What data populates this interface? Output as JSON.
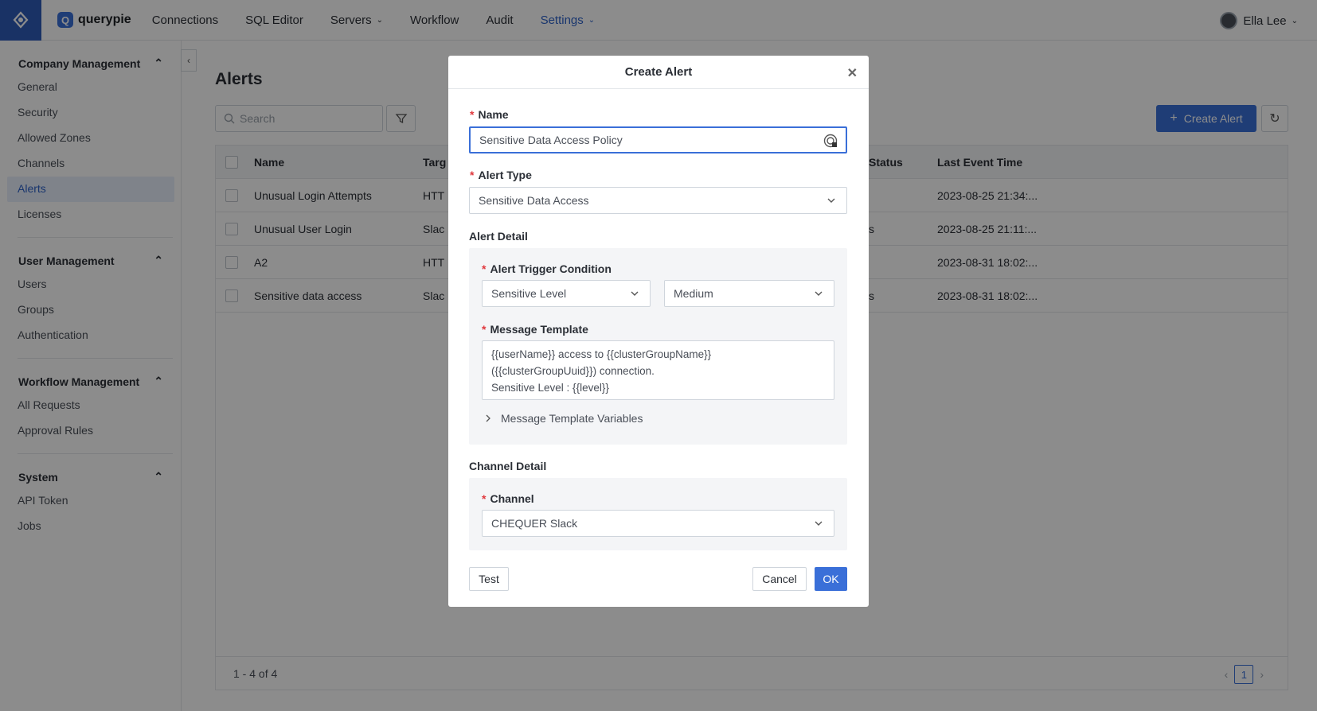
{
  "header": {
    "brand": "querypie",
    "brand_badge": "Q",
    "nav": [
      {
        "label": "Connections"
      },
      {
        "label": "SQL Editor"
      },
      {
        "label": "Servers",
        "has_caret": true
      },
      {
        "label": "Workflow"
      },
      {
        "label": "Audit"
      },
      {
        "label": "Settings",
        "has_caret": true,
        "active": true
      }
    ],
    "user_name": "Ella Lee"
  },
  "sidebar": {
    "groups": [
      {
        "title": "Company Management",
        "items": [
          "General",
          "Security",
          "Allowed Zones",
          "Channels",
          "Alerts",
          "Licenses"
        ],
        "active": "Alerts"
      },
      {
        "title": "User Management",
        "items": [
          "Users",
          "Groups",
          "Authentication"
        ]
      },
      {
        "title": "Workflow Management",
        "items": [
          "All Requests",
          "Approval Rules"
        ]
      },
      {
        "title": "System",
        "items": [
          "API Token",
          "Jobs"
        ]
      }
    ]
  },
  "main": {
    "title": "Alerts",
    "search_placeholder": "Search",
    "create_button": "Create Alert",
    "table": {
      "columns": [
        "Name",
        "Targ",
        "Status",
        "Last Event Time"
      ],
      "rows": [
        {
          "name": "Unusual Login Attempts",
          "target": "HTT",
          "status": "",
          "last_event": "2023-08-25 21:34:..."
        },
        {
          "name": "Unusual User Login",
          "target": "Slac",
          "status": "s",
          "last_event": "2023-08-25 21:11:..."
        },
        {
          "name": "A2",
          "target": "HTT",
          "status": "",
          "last_event": "2023-08-31 18:02:..."
        },
        {
          "name": "Sensitive data access",
          "target": "Slac",
          "status": "s",
          "last_event": "2023-08-31 18:02:..."
        }
      ],
      "footer": "1 - 4 of 4",
      "page": "1"
    }
  },
  "modal": {
    "title": "Create Alert",
    "name_label": "Name",
    "name_value": "Sensitive Data Access Policy",
    "alert_type_label": "Alert Type",
    "alert_type_value": "Sensitive Data Access",
    "alert_detail_title": "Alert Detail",
    "trigger_label": "Alert Trigger Condition",
    "trigger_field": "Sensitive Level",
    "trigger_value": "Medium",
    "message_label": "Message Template",
    "message_lines": [
      "{{userName}} access to {{clusterGroupName}}",
      "({{clusterGroupUuid}}) connection.",
      "Sensitive Level : {{level}}"
    ],
    "message_vars": "Message Template Variables",
    "channel_detail_title": "Channel Detail",
    "channel_label": "Channel",
    "channel_value": "CHEQUER Slack",
    "test_button": "Test",
    "cancel_button": "Cancel",
    "ok_button": "OK"
  },
  "colors": {
    "accent": "#3a6fd8",
    "brand": "#2e5bb8",
    "required": "#e0393e"
  }
}
